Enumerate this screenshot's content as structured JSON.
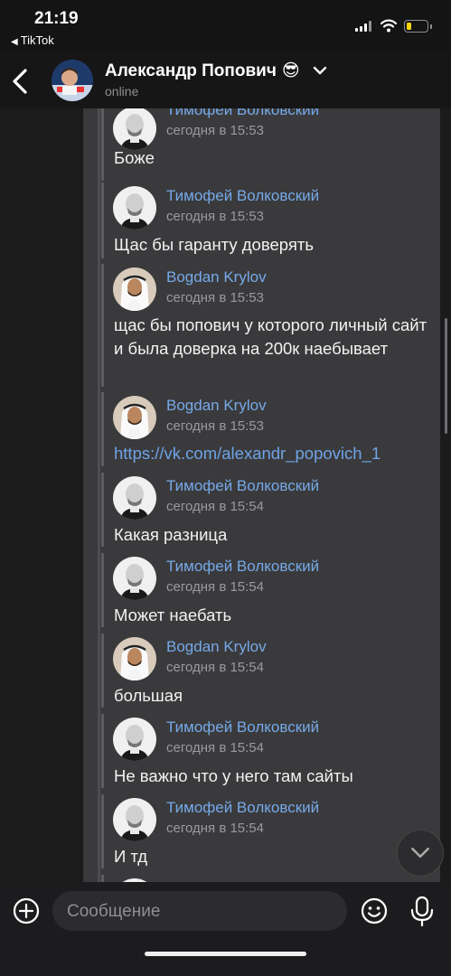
{
  "status_bar": {
    "time": "21:19",
    "back_app": "TikTok",
    "battery_color": "#ffd60a",
    "battery_level": 0.2
  },
  "header": {
    "name": "Александр Попович",
    "emoji": "😎",
    "status": "online",
    "back_icon": "chevron-left-icon",
    "dropdown_icon": "chevron-down-icon"
  },
  "messages": [
    {
      "author": "Тимофей Волковский",
      "time": "сегодня в 15:53",
      "text": "Боже",
      "avatar": "bald-man"
    },
    {
      "author": "Тимофей Волковский",
      "time": "сегодня в 15:53",
      "text": "Щас бы гаранту доверять",
      "avatar": "bald-man"
    },
    {
      "author": "Bogdan Krylov",
      "time": "сегодня в 15:53",
      "text": "щас бы попович у которого личный сайт и была доверка на 200к наебывает",
      "avatar": "sheikh"
    },
    {
      "author": "Bogdan Krylov",
      "time": "сегодня в 15:53",
      "text": "https://vk.com/alexandr_popovich_1",
      "avatar": "sheikh",
      "is_link": true
    },
    {
      "author": "Тимофей Волковский",
      "time": "сегодня в 15:54",
      "text": "Какая разница",
      "avatar": "bald-man"
    },
    {
      "author": "Тимофей Волковский",
      "time": "сегодня в 15:54",
      "text": "Может наебать",
      "avatar": "bald-man"
    },
    {
      "author": "Bogdan Krylov",
      "time": "сегодня в 15:54",
      "text": "большая",
      "avatar": "sheikh"
    },
    {
      "author": "Тимофей Волковский",
      "time": "сегодня в 15:54",
      "text": "Не важно что у него там сайты",
      "avatar": "bald-man"
    },
    {
      "author": "Тимофей Волковский",
      "time": "сегодня в 15:54",
      "text": "И тд",
      "avatar": "bald-man"
    }
  ],
  "composer": {
    "placeholder": "Сообщение",
    "add_icon": "plus-circle-icon",
    "emoji_icon": "smiley-icon",
    "mic_icon": "microphone-icon"
  },
  "colors": {
    "author": "#76a9e8",
    "link": "#6fa3e5",
    "bubble": "#3a3a3c"
  }
}
